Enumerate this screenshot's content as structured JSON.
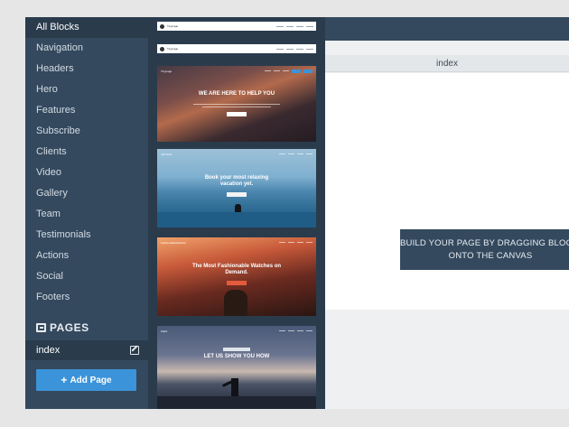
{
  "sidebar": {
    "categories": [
      {
        "label": "All Blocks"
      },
      {
        "label": "Navigation"
      },
      {
        "label": "Headers"
      },
      {
        "label": "Hero"
      },
      {
        "label": "Features"
      },
      {
        "label": "Subscribe"
      },
      {
        "label": "Clients"
      },
      {
        "label": "Video"
      },
      {
        "label": "Gallery"
      },
      {
        "label": "Team"
      },
      {
        "label": "Testimonials"
      },
      {
        "label": "Actions"
      },
      {
        "label": "Social"
      },
      {
        "label": "Footers"
      }
    ],
    "pages_title": "PAGES",
    "pages": [
      {
        "label": "index"
      }
    ],
    "add_page_label": "Add Page"
  },
  "blocks": {
    "nav_brand_1": "Tinypage",
    "nav_brand_2": "Tinypage",
    "thumbs": [
      {
        "brand": "Tinypage",
        "heading": "WE ARE HERE TO HELP YOU"
      },
      {
        "brand": "JetTravel",
        "heading": "Book your most relaxing vacation yet."
      },
      {
        "brand": "FashionableWatches",
        "heading": "The Most Fashionable Watches on Demand."
      },
      {
        "brand": "Flash",
        "heading": "LET US SHOW YOU HOW"
      }
    ]
  },
  "canvas": {
    "tab_label": "index",
    "hint_line1": "BUILD YOUR PAGE BY DRAGGING BLOCKS FROM THE SIDEBAR",
    "hint_line2": "ONTO THE CANVAS"
  }
}
